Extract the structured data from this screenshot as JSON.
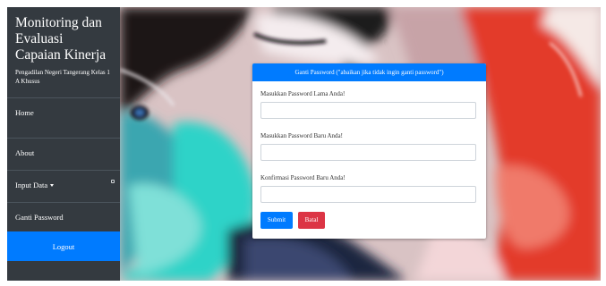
{
  "sidebar": {
    "title": "Monitoring dan Evaluasi Capaian Kinerja",
    "subtitle": "Pengadilan Negeri Tangerang Kelas 1 A Khusus",
    "items": [
      {
        "label": "Home"
      },
      {
        "label": "About"
      },
      {
        "label": "Input Data"
      },
      {
        "label": "Ganti Password"
      }
    ],
    "logout_label": "Logout"
  },
  "form": {
    "header": "Ganti Password (\"abaikan jika tidak ingin ganti password\")",
    "old_password_label": "Masukkan Password Lama Anda!",
    "new_password_label": "Masukkan Password Baru Anda!",
    "confirm_password_label": "Konfirmasi Password Baru Anda!",
    "submit_label": "Submit",
    "cancel_label": "Batal"
  },
  "colors": {
    "sidebar_bg": "#343a40",
    "primary": "#007bff",
    "danger": "#dc3545"
  }
}
